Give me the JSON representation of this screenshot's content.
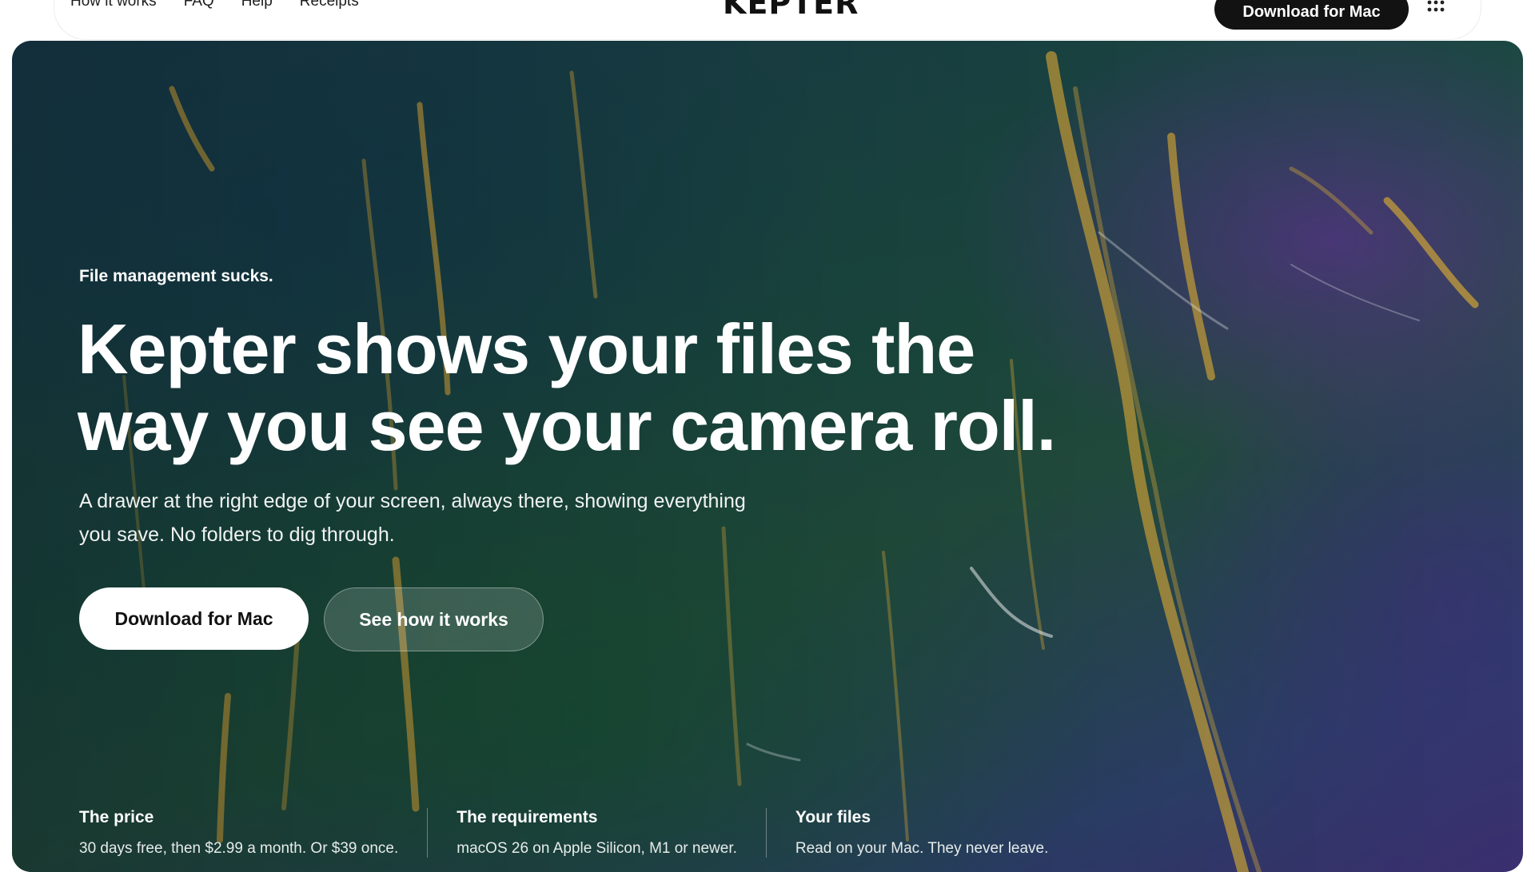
{
  "nav": {
    "links": [
      "How it works",
      "FAQ",
      "Help",
      "Receipts"
    ],
    "logo": "KEPTER",
    "download_label": "Download for Mac",
    "menu_icon": "grid-dots-icon"
  },
  "hero": {
    "eyebrow": "File management sucks.",
    "headline_line1": "Kepter shows your files the",
    "headline_line2": "way you see your camera roll.",
    "subtext": "A drawer at the right edge of your screen, always there, showing everything you save. No folders to dig through.",
    "primary_button": "Download for Mac",
    "secondary_button": "See how it works"
  },
  "facts": [
    {
      "title": "The price",
      "text": "30 days free, then $2.99 a month. Or $39 once."
    },
    {
      "title": "The requirements",
      "text": "macOS 26 on Apple Silicon, M1 or newer."
    },
    {
      "title": "Your files",
      "text": "Read on your Mac. They never leave."
    }
  ],
  "colors": {
    "nav_button_bg": "#121212",
    "hero_teal": "#1b4a3f",
    "hero_purple": "#3b2f6e",
    "seaweed_gold": "#c9a13a"
  }
}
